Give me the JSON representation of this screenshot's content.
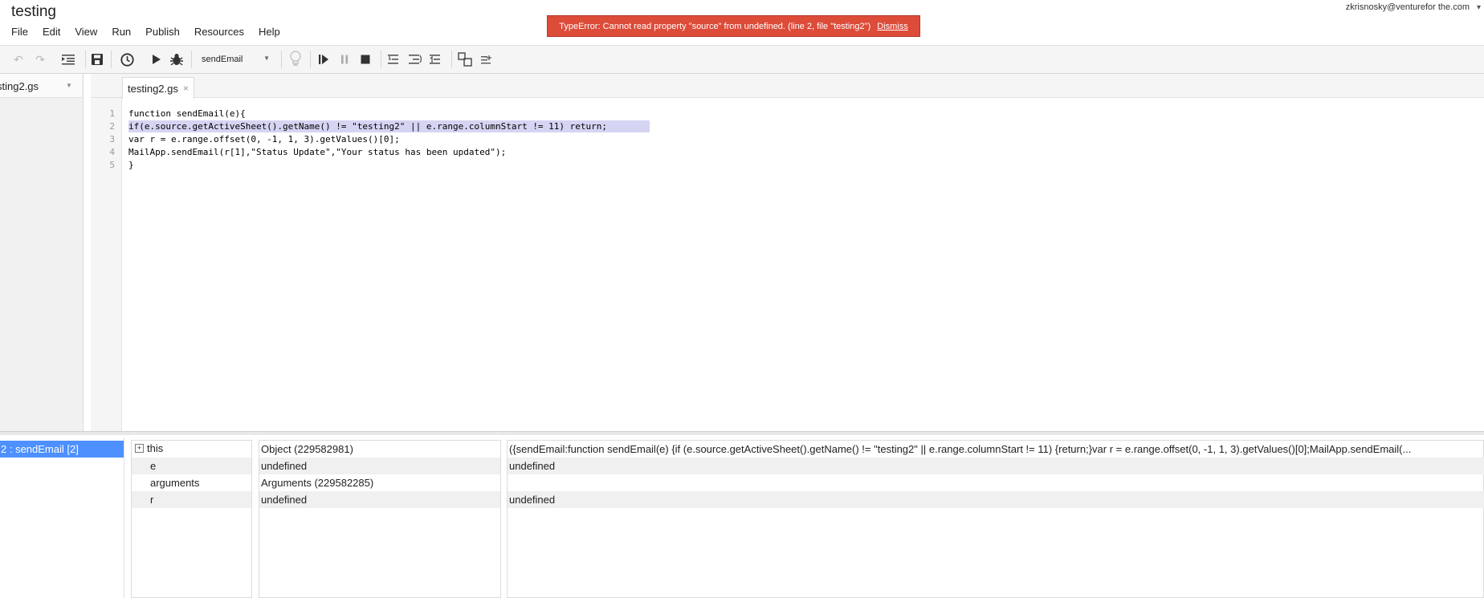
{
  "header": {
    "title": "testing",
    "user_email": "zkrisnosky@venturefor the.com",
    "menus": [
      "File",
      "Edit",
      "View",
      "Run",
      "Publish",
      "Resources",
      "Help"
    ]
  },
  "error": {
    "message": "TypeError: Cannot read property \"source\" from undefined. (line 2, file \"testing2\")",
    "dismiss": "Dismiss"
  },
  "toolbar": {
    "function_select": "sendEmail",
    "icons": [
      "undo-icon",
      "redo-icon",
      "indent-icon",
      "save-icon",
      "triggers-icon",
      "run-icon",
      "debug-icon",
      "lightbulb-icon",
      "continue-icon",
      "pause-icon",
      "stop-icon",
      "step-into-icon",
      "step-over-icon",
      "step-out-icon",
      "toggle-debug-panel-icon",
      "expression-icon"
    ]
  },
  "file_panel": {
    "selected_file": "sting2.gs"
  },
  "editor": {
    "tab_label": "testing2.gs",
    "line_numbers": [
      "1",
      "2",
      "3",
      "4",
      "5"
    ],
    "lines": [
      "function sendEmail(e){",
      "if(e.source.getActiveSheet().getName() != \"testing2\" || e.range.columnStart != 11) return;",
      "var r = e.range.offset(0, -1, 1, 3).getValues()[0];",
      "MailApp.sendEmail(r[1],\"Status Update\",\"Your status has been updated\");",
      "}"
    ]
  },
  "debugger": {
    "callstack": "2 : sendEmail [2]",
    "variables": [
      {
        "name": "this",
        "type": "Object (229582981)",
        "value": "({sendEmail:function sendEmail(e) {if (e.source.getActiveSheet().getName() != \"testing2\" || e.range.columnStart != 11) {return;}var r = e.range.offset(0, -1, 1, 3).getValues()[0];MailApp.sendEmail(..."
      },
      {
        "name": "e",
        "type": "undefined",
        "value": "undefined"
      },
      {
        "name": "arguments",
        "type": "Arguments (229582285)",
        "value": ""
      },
      {
        "name": "r",
        "type": "undefined",
        "value": "undefined"
      }
    ]
  }
}
